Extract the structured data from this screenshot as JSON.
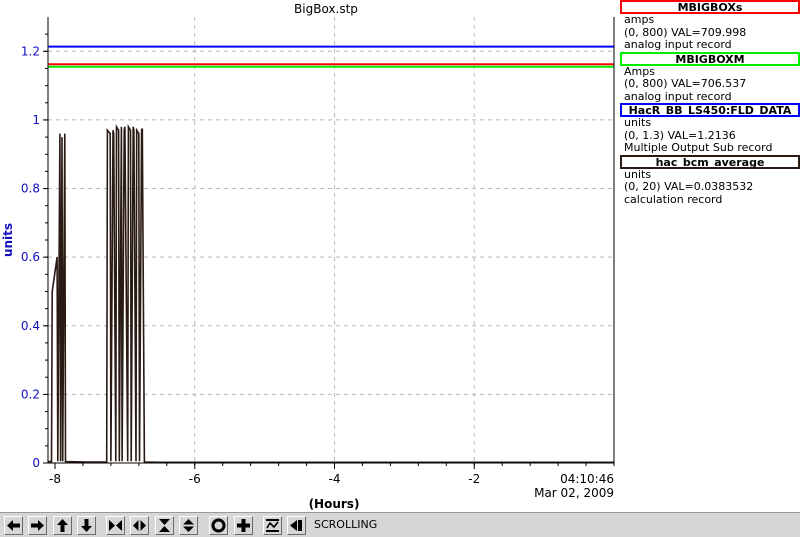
{
  "chart_data": {
    "type": "line",
    "title": "BigBox.stp",
    "ylabel": "units",
    "xlabel": "(Hours)",
    "ylim": [
      0,
      1.3
    ],
    "xlim": [
      -8.1,
      0
    ],
    "xticks": [
      "-8",
      "-6",
      "-4",
      "-2"
    ],
    "yticks": [
      "0",
      "0.2",
      "0.4",
      "0.6",
      "0.8",
      "1",
      "1.2"
    ],
    "time_label": "04:10:46",
    "date_label": "Mar 02, 2009",
    "grid": true,
    "series": [
      {
        "name": "MBIGBOXs",
        "color": "#ff0000",
        "x": [
          -8.1,
          0
        ],
        "values": [
          1.162,
          1.162
        ]
      },
      {
        "name": "MBIGBOXM",
        "color": "#00ee00",
        "x": [
          -8.1,
          0
        ],
        "values": [
          1.155,
          1.155
        ]
      },
      {
        "name": "HacR_BB_LS450:FLD_DATA",
        "color": "#0000ff",
        "x": [
          -8.1,
          0
        ],
        "values": [
          1.2136,
          1.2136
        ]
      },
      {
        "name": "hac_bcm_average",
        "color": "#2a1a14",
        "x": [
          -8.1,
          -8.05,
          -8.04,
          -7.97,
          -7.96,
          -7.93,
          -7.92,
          -7.9,
          -7.89,
          -7.86,
          -7.85,
          -7.55,
          -7.26,
          -7.25,
          -7.21,
          -7.2,
          -7.17,
          -7.16,
          -7.13,
          -7.12,
          -7.09,
          -7.08,
          -7.05,
          -7.04,
          -7.01,
          -7.0,
          -6.96,
          -6.95,
          -6.92,
          -6.91,
          -6.88,
          -6.87,
          -6.84,
          -6.83,
          -6.8,
          -6.79,
          -6.76,
          -6.75,
          -6.72,
          -6.71,
          -6.5,
          -6.0,
          -4.0,
          -2.0,
          0
        ],
        "values": [
          0.004,
          0.004,
          0.5,
          0.6,
          0.005,
          0.96,
          0.005,
          0.95,
          0.005,
          0.96,
          0.004,
          0.003,
          0.003,
          0.97,
          0.96,
          0.005,
          0.97,
          0.96,
          0.005,
          0.98,
          0.97,
          0.005,
          0.98,
          0.005,
          0.97,
          0.98,
          0.005,
          0.98,
          0.97,
          0.005,
          0.98,
          0.97,
          0.005,
          0.97,
          0.96,
          0.005,
          0.97,
          0.975,
          0.004,
          0.003,
          0.002,
          0.002,
          0.002,
          0.002,
          0.002
        ]
      }
    ]
  },
  "legend": [
    {
      "name": "MBIGBOXs",
      "unit": "amps",
      "range_val": "(0, 800) VAL=709.998",
      "record": "analog input record",
      "color": "#ff0000"
    },
    {
      "name": "MBIGBOXM",
      "unit": "Amps",
      "range_val": "(0, 800) VAL=706.537",
      "record": "analog input record",
      "color": "#00ee00"
    },
    {
      "name": "HacR_BB_LS450:FLD_DATA",
      "unit": "units",
      "range_val": "(0, 1.3) VAL=1.2136",
      "record": "Multiple Output Sub record",
      "color": "#0000ff"
    },
    {
      "name": "hac_bcm_average",
      "unit": "units",
      "range_val": "(0, 20) VAL=0.0383532",
      "record": "calculation record",
      "color": "#2a1a14"
    }
  ],
  "toolbar": {
    "status": "SCROLLING",
    "buttons": [
      {
        "icon": "arrow-left-icon"
      },
      {
        "icon": "arrow-right-icon"
      },
      {
        "icon": "arrow-up-icon"
      },
      {
        "icon": "arrow-down-icon"
      },
      {
        "icon": "compress-horizontal-icon"
      },
      {
        "icon": "expand-horizontal-icon"
      },
      {
        "icon": "compress-vertical-icon"
      },
      {
        "icon": "expand-vertical-icon"
      },
      {
        "icon": "zoom-out-icon"
      },
      {
        "icon": "zoom-in-icon"
      },
      {
        "icon": "auto-scale-icon"
      },
      {
        "icon": "scroll-left-icon"
      }
    ]
  }
}
